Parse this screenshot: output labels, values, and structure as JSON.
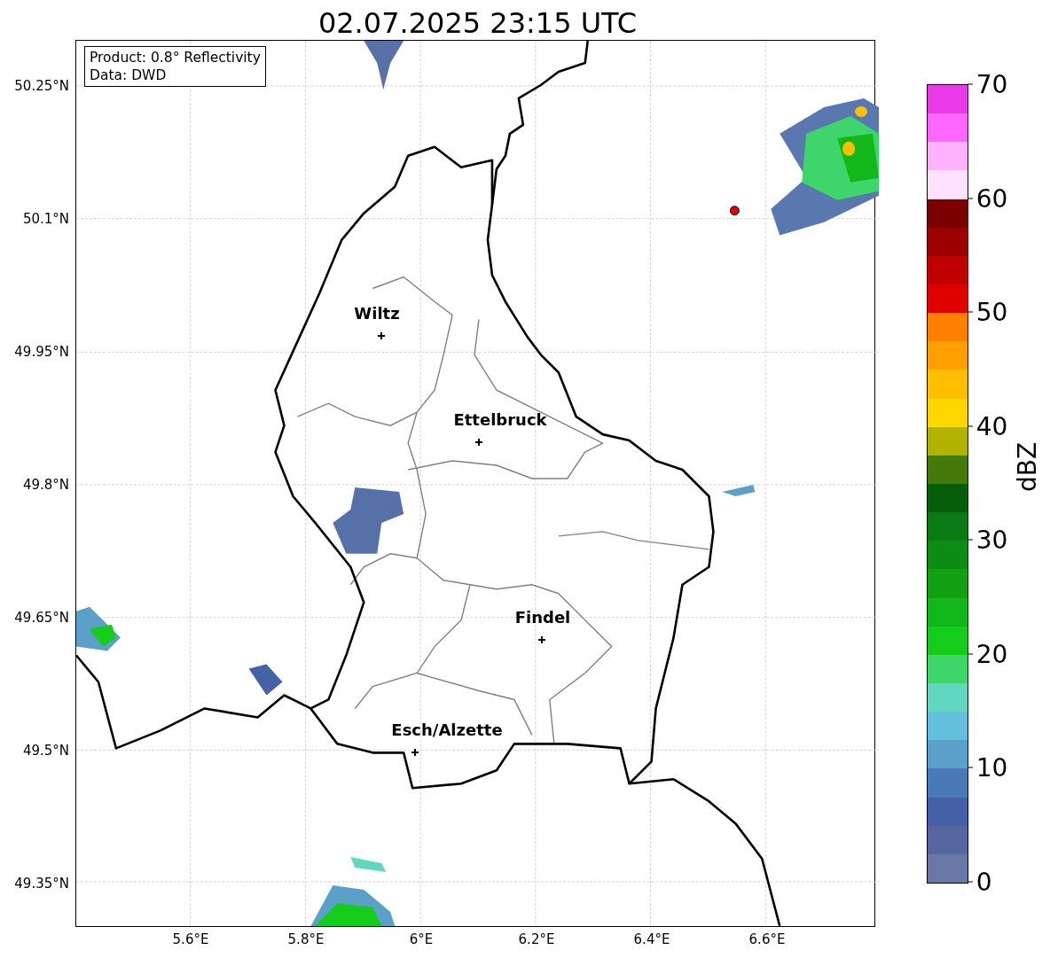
{
  "title": "02.07.2025 23:15 UTC",
  "info_box": [
    "Product: 0.8° Reflectivity",
    "Data: DWD"
  ],
  "lat_ticks": [
    "50.25°N",
    "50.1°N",
    "49.95°N",
    "49.8°N",
    "49.65°N",
    "49.5°N",
    "49.35°N"
  ],
  "lon_ticks": [
    "5.6°E",
    "5.8°E",
    "6°E",
    "6.2°E",
    "6.4°E",
    "6.6°E"
  ],
  "cities": [
    {
      "name": "Wiltz"
    },
    {
      "name": "Ettelbruck"
    },
    {
      "name": "Findel"
    },
    {
      "name": "Esch/Alzette"
    }
  ],
  "colorbar": {
    "label": "dBZ",
    "ticks": [
      "70",
      "60",
      "50",
      "40",
      "30",
      "20",
      "10",
      "0"
    ],
    "bands": [
      {
        "color": "#6a78a8"
      },
      {
        "color": "#5566a0"
      },
      {
        "color": "#4460a6"
      },
      {
        "color": "#4a7ab6"
      },
      {
        "color": "#5aa0c8"
      },
      {
        "color": "#62c0dc"
      },
      {
        "color": "#60d8c0"
      },
      {
        "color": "#3ed66a"
      },
      {
        "color": "#14cc1a"
      },
      {
        "color": "#12b81a"
      },
      {
        "color": "#10a012"
      },
      {
        "color": "#0c8c12"
      },
      {
        "color": "#0a7a12"
      },
      {
        "color": "#075e0a"
      },
      {
        "color": "#447a0a"
      },
      {
        "color": "#b2b200"
      },
      {
        "color": "#ffd700"
      },
      {
        "color": "#ffbf00"
      },
      {
        "color": "#ff9f00"
      },
      {
        "color": "#ff7f00"
      },
      {
        "color": "#e00000"
      },
      {
        "color": "#c00000"
      },
      {
        "color": "#9c0000"
      },
      {
        "color": "#7a0000"
      },
      {
        "color": "#ffe0ff"
      },
      {
        "color": "#ffb3ff"
      },
      {
        "color": "#ff66ff"
      },
      {
        "color": "#e93ae9"
      }
    ]
  }
}
